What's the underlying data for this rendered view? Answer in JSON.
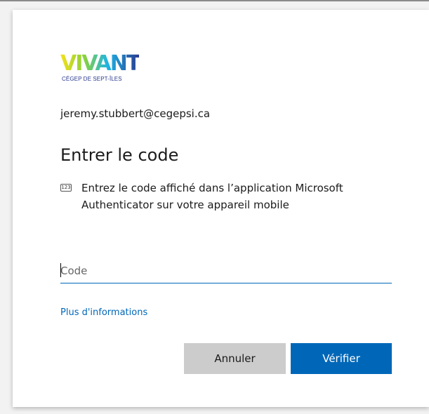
{
  "logo": {
    "wordmark": "VIVANT",
    "subtitle": "CÉGEP DE SEPT-ÎLES"
  },
  "account": {
    "email": "jeremy.stubbert@cegepsi.ca"
  },
  "header": {
    "title": "Entrer le code"
  },
  "instructions": {
    "icon_label": "123",
    "icon": "numeric-code-icon",
    "text": "Entrez le code affiché dans l’application Microsoft Authenticator sur votre appareil mobile"
  },
  "code_field": {
    "placeholder": "Code",
    "value": ""
  },
  "links": {
    "more_info": "Plus d'informations"
  },
  "actions": {
    "cancel_label": "Annuler",
    "verify_label": "Vérifier"
  },
  "colors": {
    "accent": "#0067b8",
    "cancel_bg": "#cccccc",
    "background": "#f2f2f2"
  }
}
